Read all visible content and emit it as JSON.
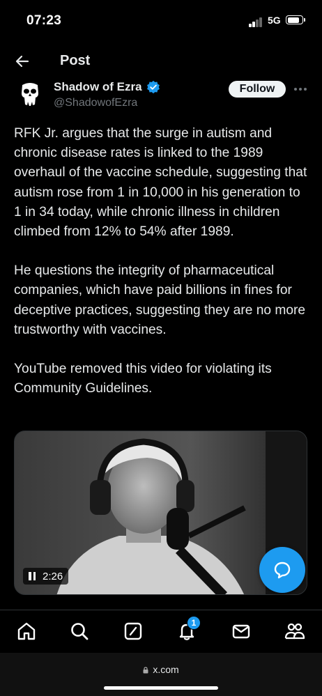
{
  "status_bar": {
    "time": "07:23",
    "network": "5G",
    "battery_level": 0.85
  },
  "header": {
    "title": "Post"
  },
  "author": {
    "name": "Shadow of Ezra",
    "handle": "@ShadowofEzra",
    "verified": true
  },
  "follow_label": "Follow",
  "tweet": {
    "paragraphs": [
      "RFK Jr. argues that the surge in autism and chronic disease rates is linked to the 1989 overhaul of the vaccine schedule, suggesting that autism rose from 1 in 10,000 in his generation to 1 in 34 today, while chronic illness in children climbed from 12% to 54% after 1989.",
      "He questions the integrity of pharmaceutical companies, which have paid billions in fines for deceptive practices, suggesting they are no more trustworthy with vaccines.",
      "YouTube removed this video for violating its Community Guidelines."
    ]
  },
  "video": {
    "time_remaining": "2:26"
  },
  "bottom_nav": {
    "items": [
      "home-icon",
      "search-icon",
      "grok-icon",
      "notifications-icon",
      "messages-icon",
      "communities-icon"
    ],
    "notification_count": "1"
  },
  "url_bar": {
    "domain": "x.com"
  },
  "colors": {
    "accent": "#1d9bf0",
    "background": "#000000",
    "text": "#e7e9ea",
    "muted": "#71767b"
  }
}
